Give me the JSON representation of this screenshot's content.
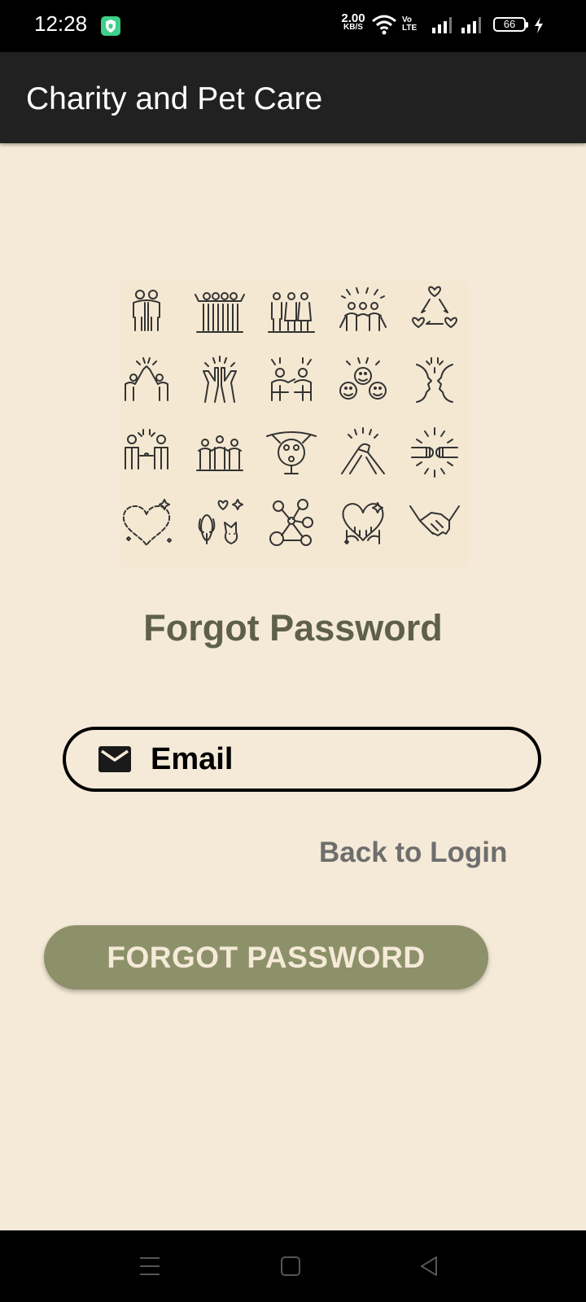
{
  "status_bar": {
    "time": "12:28",
    "net_speed_value": "2.00",
    "net_speed_unit": "KB/S",
    "volte_label_top": "Vo",
    "volte_label_bottom": "LTE",
    "battery_level": "66",
    "icons": [
      "shield-app-icon",
      "wifi-icon",
      "signal-icon",
      "signal-icon",
      "battery-icon",
      "charging-icon"
    ]
  },
  "app_bar": {
    "title": "Charity and Pet Care"
  },
  "page": {
    "heading": "Forgot Password",
    "email": {
      "placeholder": "Email",
      "value": "",
      "icon": "mail-icon"
    },
    "back_link": "Back to Login",
    "submit_label": "FORGOT PASSWORD"
  },
  "nav_bar": {
    "icons": [
      "menu-icon",
      "home-icon",
      "back-icon"
    ]
  },
  "colors": {
    "background": "#f5ead7",
    "app_bar": "#212121",
    "heading": "#5e6147",
    "button": "#8d916a",
    "link": "#6e6e6e"
  }
}
